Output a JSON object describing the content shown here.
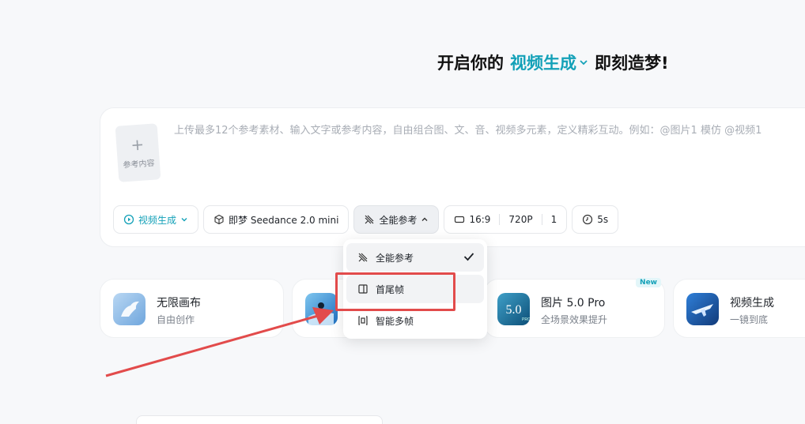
{
  "headline": {
    "prefix": "开启你的",
    "mode": "视频生成",
    "suffix": "即刻造梦!"
  },
  "prompt": {
    "upload_label": "参考内容",
    "placeholder": "上传最多12个参考素材、输入文字或参考内容，自由组合图、文、音、视频多元素，定义精彩互动。例如：@图片1 模仿 @视频1"
  },
  "toolbar": {
    "mode_label": "视频生成",
    "model_label": "即梦 Seedance 2.0 mini",
    "reference_label": "全能参考",
    "ratio": "16:9",
    "resolution": "720P",
    "count": "1",
    "duration": "5s"
  },
  "dropdown": {
    "items": [
      {
        "label": "全能参考",
        "icon": "all-reference-icon",
        "selected": true
      },
      {
        "label": "首尾帧",
        "icon": "first-last-frame-icon",
        "selected": false
      },
      {
        "label": "智能多帧",
        "icon": "multi-frame-icon",
        "selected": false
      }
    ]
  },
  "features": [
    {
      "title": "无限画布",
      "sub": "自由创作",
      "icon": "pegasus-thumb"
    },
    {
      "title": "",
      "sub": "",
      "icon": "surf-thumb"
    },
    {
      "title": "图片 5.0 Pro",
      "sub": "全场景效果提升",
      "badge": "New",
      "icon": "image-5-thumb"
    },
    {
      "title": "视频生成",
      "sub": "一镜到底",
      "icon": "plane-thumb"
    }
  ],
  "annotation_colors": {
    "highlight": "#e24b4b",
    "accent": "#14a1b8"
  }
}
